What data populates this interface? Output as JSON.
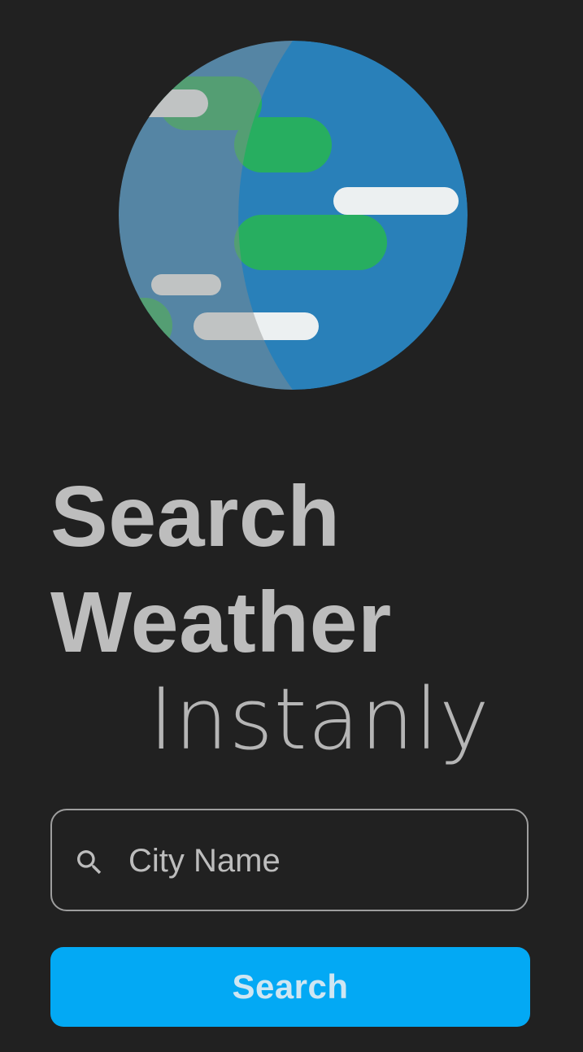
{
  "logo": {
    "icon": "globe-weather-icon",
    "colors": {
      "ocean": "#2980b9",
      "ocean_shade": "#4a7a9c",
      "land": "#27ae60",
      "cloud": "#ecf0f1"
    }
  },
  "title": {
    "line1": "Search",
    "line2": "Weather",
    "subtitle": "Instanly"
  },
  "search": {
    "icon": "search-icon",
    "placeholder": "City Name",
    "value": ""
  },
  "button": {
    "label": "Search",
    "color": "#03a9f4"
  },
  "colors": {
    "background": "#212121",
    "text": "#bdbdbd",
    "border": "#9e9e9e"
  }
}
